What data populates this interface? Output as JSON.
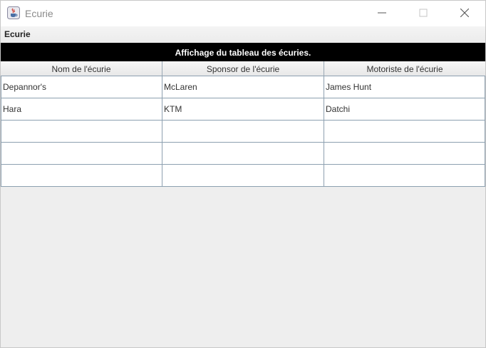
{
  "window": {
    "title": "Ecurie",
    "icon": "java-cup-icon"
  },
  "menubar": {
    "items": [
      {
        "label": "Ecurie"
      }
    ]
  },
  "banner": {
    "text": "Affichage du tableau des écuries."
  },
  "table": {
    "columns": [
      "Nom de l'écurie",
      "Sponsor de l'écurie",
      "Motoriste de l'écurie"
    ],
    "rows": [
      [
        "Depannor's",
        "McLaren",
        "James Hunt"
      ],
      [
        "Hara",
        "KTM",
        "Datchi"
      ],
      [
        "",
        "",
        ""
      ],
      [
        "",
        "",
        ""
      ],
      [
        "",
        "",
        ""
      ]
    ]
  }
}
